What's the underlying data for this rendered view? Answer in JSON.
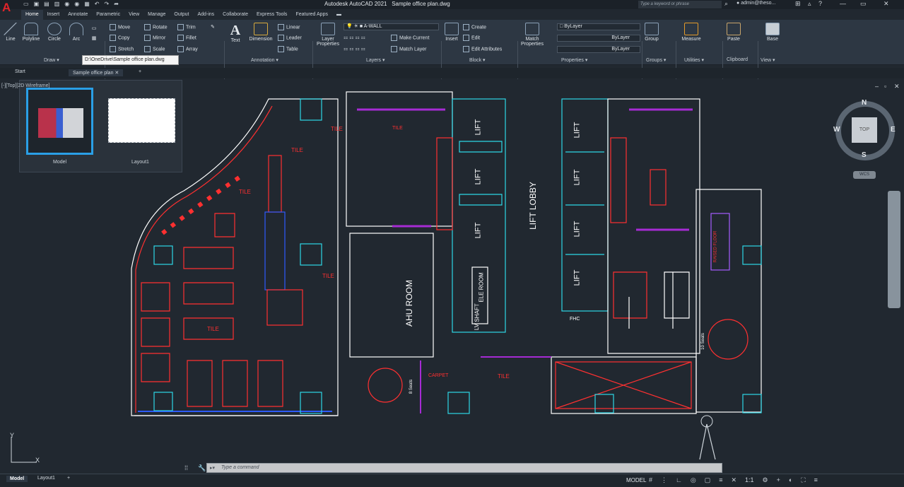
{
  "app": {
    "title": "Autodesk AutoCAD 2021",
    "file": "Sample office plan.dwg",
    "logo": "A"
  },
  "search": {
    "placeholder": "Type a keyword or phrase"
  },
  "user": {
    "name": "admin@theso..."
  },
  "ribbon_tabs": [
    "Home",
    "Insert",
    "Annotate",
    "Parametric",
    "View",
    "Manage",
    "Output",
    "Add-ins",
    "Collaborate",
    "Express Tools",
    "Featured Apps"
  ],
  "active_tab": "Home",
  "draw": {
    "tools": [
      "Line",
      "Polyline",
      "Circle",
      "Arc"
    ],
    "title": "Draw ▾"
  },
  "modify": {
    "tools": [
      "Move",
      "Copy",
      "Stretch",
      "Rotate",
      "Mirror",
      "Scale",
      "Trim",
      "Fillet",
      "Array"
    ]
  },
  "annotation": {
    "tools": [
      "Text",
      "Dimension",
      "Linear",
      "Leader",
      "Table"
    ],
    "title": "Annotation ▾"
  },
  "layers": {
    "current": "A-WALL",
    "tools": [
      "Layer Properties",
      "Make Current",
      "Match Layer"
    ],
    "title": "Layers ▾"
  },
  "block": {
    "tools": [
      "Insert",
      "Create",
      "Edit",
      "Edit Attributes"
    ],
    "title": "Block ▾"
  },
  "properties": {
    "tools": [
      "Match Properties"
    ],
    "values": [
      "ByLayer",
      "ByLayer",
      "ByLayer"
    ],
    "title": "Properties ▾"
  },
  "groups": {
    "tools": [
      "Group"
    ],
    "title": "Groups ▾"
  },
  "utilities": {
    "tools": [
      "Measure"
    ],
    "title": "Utilities ▾"
  },
  "clipboard": {
    "tools": [
      "Paste"
    ],
    "title": "Clipboard"
  },
  "view": {
    "tools": [
      "Base"
    ],
    "title": "View ▾"
  },
  "tooltip": "D:\\OneDrive\\Sample office plan.dwg",
  "file_tabs": [
    "Start",
    "Sample office plan"
  ],
  "viewport": {
    "control": "[-][Top][2D Wireframe]"
  },
  "layout_thumbs": [
    "Model",
    "Layout1"
  ],
  "compass": {
    "n": "N",
    "s": "S",
    "e": "E",
    "w": "W",
    "top": "TOP",
    "wcs": "WCS"
  },
  "drawing": {
    "labels": [
      "TILE",
      "TILE",
      "TILE",
      "TILE",
      "TILE",
      "TILE",
      "TILE",
      "LIFT",
      "LIFT",
      "LIFT",
      "LIFT",
      "LIFT",
      "LIFT",
      "LIFT",
      "LIFT",
      "LIFT LOBBY",
      "AHU ROOM",
      "ELE ROOM",
      "SHAFT",
      "LV",
      "FHC",
      "8 Seats",
      "10 Seats",
      "CARPET",
      "RAISED FLOOR"
    ]
  },
  "command": {
    "placeholder": "Type a command"
  },
  "status_tabs": [
    "Model",
    "Layout1"
  ],
  "status": {
    "mode": "MODEL",
    "scale": "1:1"
  },
  "ucs": {
    "x": "X",
    "y": "Y"
  }
}
